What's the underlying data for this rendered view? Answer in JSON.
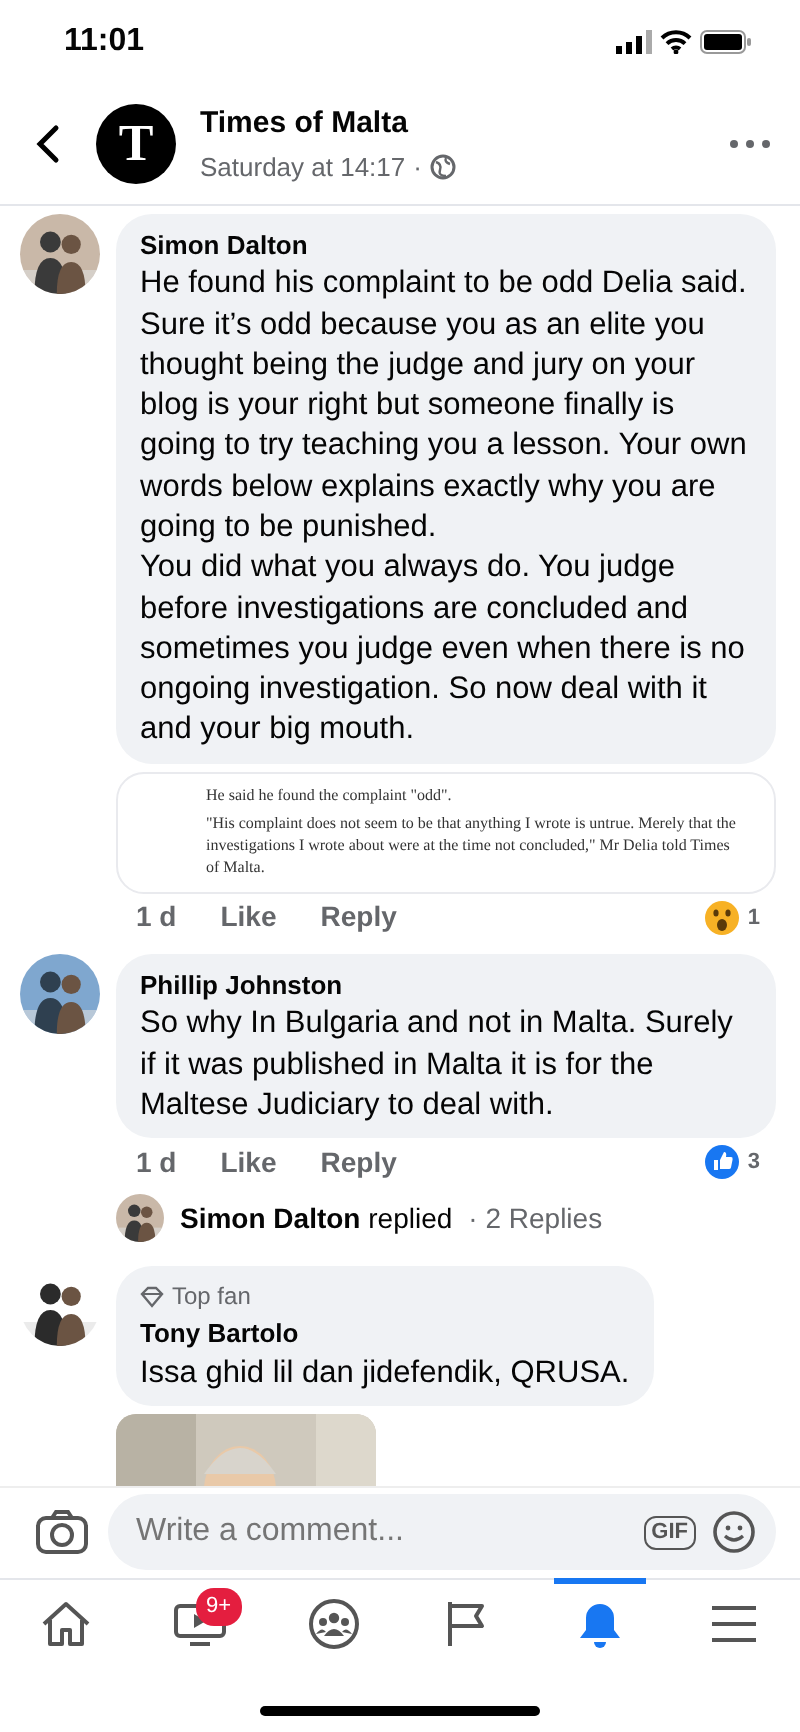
{
  "status_bar": {
    "time": "11:01"
  },
  "header": {
    "logo_letter": "T",
    "page_name": "Times of Malta",
    "timestamp": "Saturday at 14:17",
    "separator": "·"
  },
  "comments": [
    {
      "author": "Simon Dalton",
      "paragraphs": [
        "He found his complaint to be odd Delia said. Sure it’s odd because you as an elite you thought being the judge and jury on your blog is your right but someone finally is going to try teaching you a lesson. Your own words below explains exactly why you are going to be punished.",
        "You did what you always do. You judge before investigations are concluded and sometimes you judge even when there is no ongoing investigation. So now deal with it and your big mouth."
      ],
      "quote": [
        "He said he found the complaint \"odd\".",
        "\"His complaint does not seem to be that anything I wrote is untrue. Merely that the investigations I wrote about were at the time not concluded,\" Mr Delia told Times of Malta."
      ],
      "age": "1 d",
      "like": "Like",
      "reply": "Reply",
      "reaction": {
        "kind": "wow",
        "count": "1"
      }
    },
    {
      "author": "Phillip Johnston",
      "paragraphs": [
        "So why In Bulgaria and not in Malta. Surely if it was published in Malta it is for the Maltese Judiciary to deal with."
      ],
      "age": "1 d",
      "like": "Like",
      "reply": "Reply",
      "reaction": {
        "kind": "like",
        "count": "3"
      },
      "replies_summary": {
        "text": "**Simon Dalton** replied",
        "count": "· 2 Replies"
      }
    },
    {
      "badge": "Top fan",
      "author": "Tony Bartolo",
      "paragraphs": [
        "Issa ghid lil dan jidefendik, QRUSA."
      ],
      "attachment": {
        "kind": "picture"
      }
    }
  ],
  "composer": {
    "placeholder": "Write a comment...",
    "gif_label": "GIF"
  },
  "tab_bar": [
    {
      "kind": "home",
      "selected": false
    },
    {
      "kind": "video",
      "selected": false,
      "badge": "9+"
    },
    {
      "kind": "groups",
      "selected": false
    },
    {
      "kind": "pages",
      "selected": false
    },
    {
      "kind": "notifications",
      "selected": true
    },
    {
      "kind": "menu",
      "selected": false
    }
  ]
}
